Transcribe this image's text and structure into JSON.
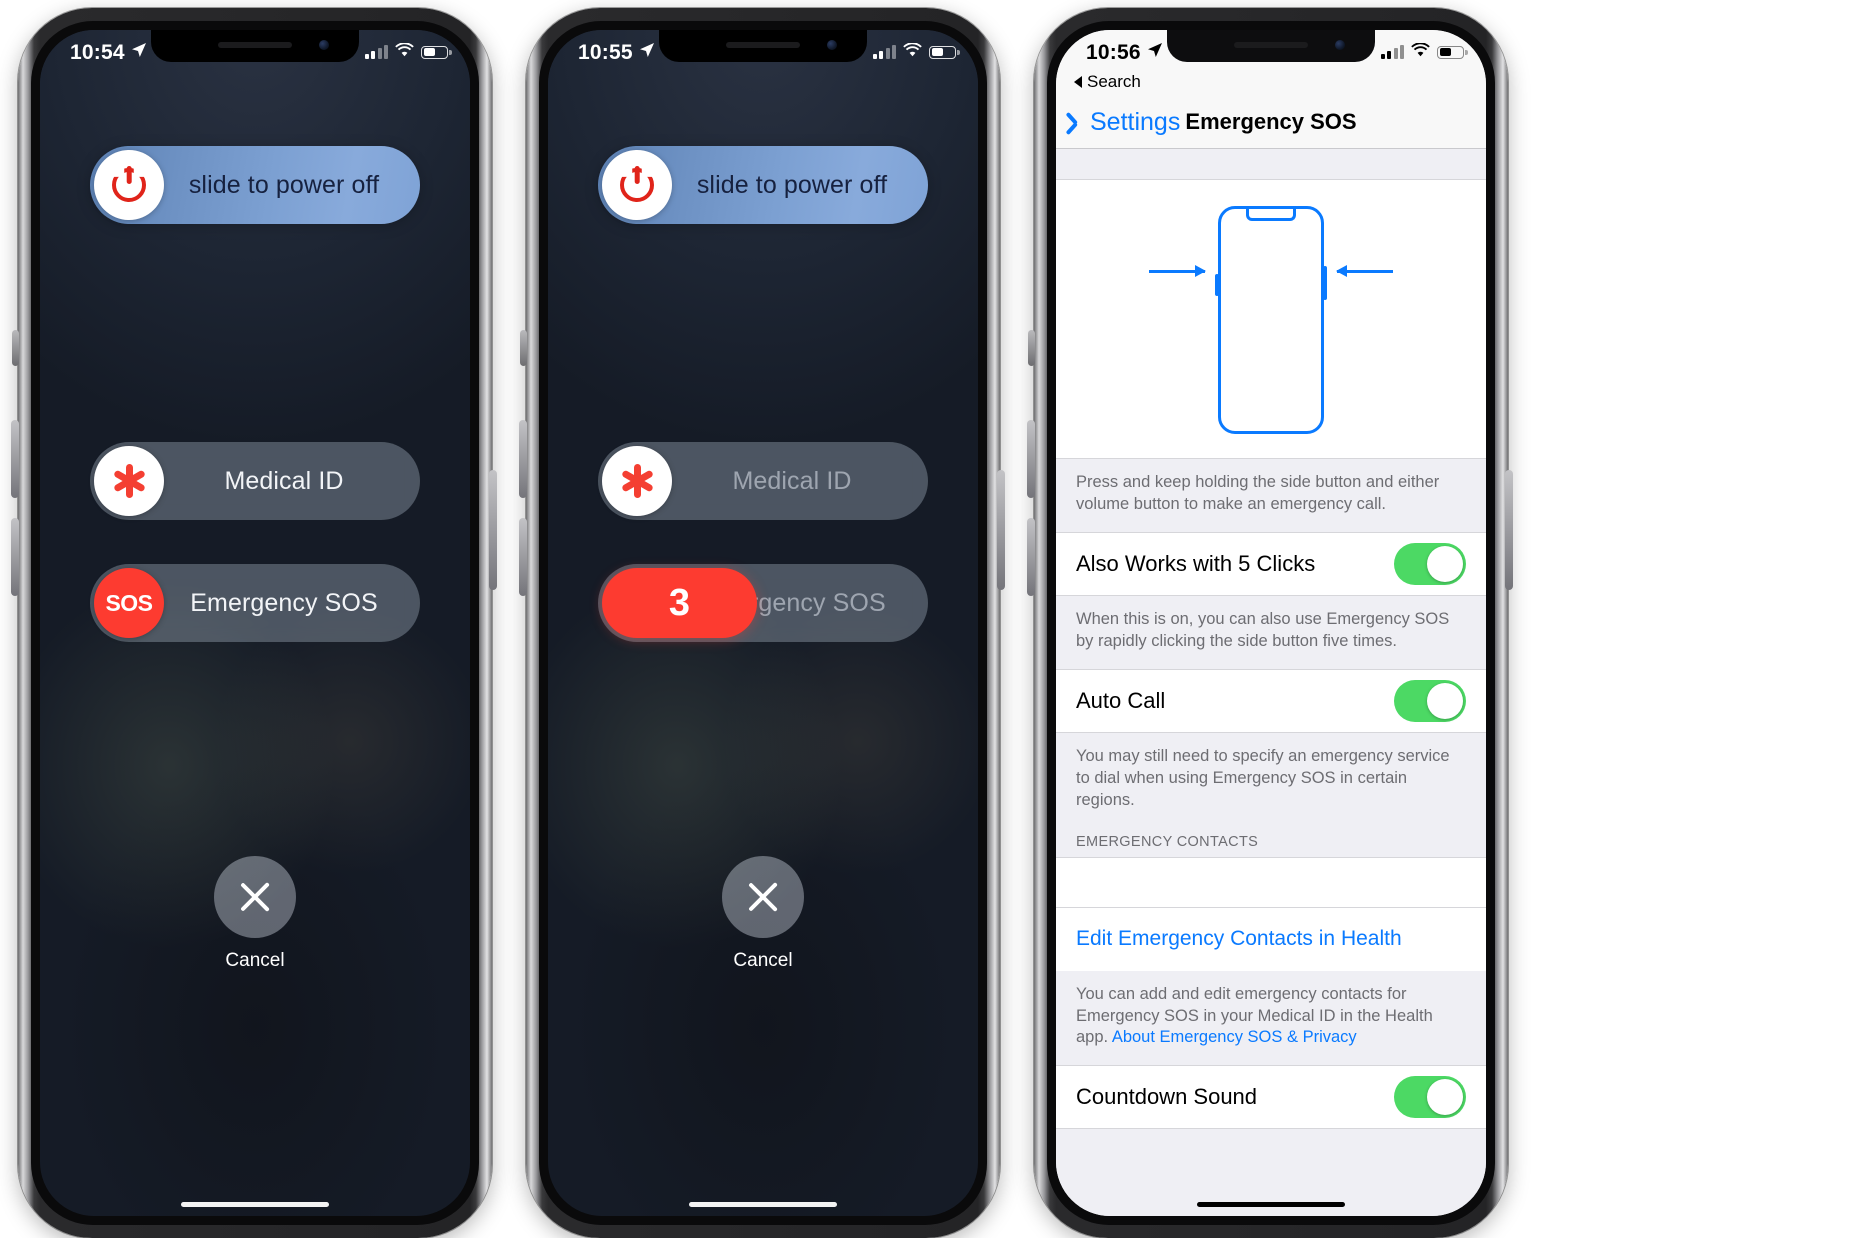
{
  "phones": [
    {
      "id": "power-off-screen",
      "status": {
        "time": "10:54",
        "location_icon": "location-arrow-icon",
        "signal_bars": 3,
        "wifi": "wifi-icon",
        "battery": "battery-icon"
      },
      "power_slider": {
        "label": "slide to power off",
        "icon": "power-icon"
      },
      "medical_slider": {
        "label": "Medical ID",
        "icon": "medical-id-icon"
      },
      "sos_slider": {
        "label": "Emergency SOS",
        "icon_label": "SOS"
      },
      "cancel": {
        "label": "Cancel",
        "icon": "close-icon"
      }
    },
    {
      "id": "sos-countdown-screen",
      "status": {
        "time": "10:55",
        "location_icon": "location-arrow-icon",
        "signal_bars": 3,
        "wifi": "wifi-icon",
        "battery": "battery-icon"
      },
      "power_slider": {
        "label": "slide to power off",
        "icon": "power-icon"
      },
      "medical_slider": {
        "label": "Medical ID",
        "icon": "medical-id-icon"
      },
      "sos_slider": {
        "label": "Emergency SOS",
        "countdown": "3"
      },
      "cancel": {
        "label": "Cancel",
        "icon": "close-icon"
      }
    }
  ],
  "settings": {
    "status": {
      "time": "10:56",
      "location_icon": "location-arrow-icon",
      "signal_bars": 3,
      "wifi": "wifi-icon",
      "battery": "battery-icon"
    },
    "breadcrumb": "Search",
    "back_label": "Settings",
    "title": "Emergency SOS",
    "illustration": "iphone-side-button-press-diagram",
    "hero_footnote": "Press and keep holding the side button and either volume button to make an emergency call.",
    "rows": [
      {
        "label": "Also Works with 5 Clicks",
        "toggle": "on"
      },
      {
        "label": "Auto Call",
        "toggle": "on"
      },
      {
        "label": "Countdown Sound",
        "toggle": "on"
      }
    ],
    "five_clicks_footnote": "When this is on, you can also use Emergency SOS by rapidly clicking the side button five times.",
    "auto_call_footnote": "You may still need to specify an emergency service to dial when using Emergency SOS in certain regions.",
    "contacts_header": "EMERGENCY CONTACTS",
    "edit_contacts_link": "Edit Emergency Contacts in Health",
    "contacts_footnote": "You can add and edit emergency contacts for Emergency SOS in your Medical ID in the Health app.",
    "privacy_link": "About Emergency SOS & Privacy"
  },
  "colors": {
    "accent_blue": "#0a7aff",
    "sos_red": "#fd3b30",
    "toggle_green": "#4cd964",
    "power_red": "#e0241a",
    "settings_bg": "#efeff4"
  }
}
